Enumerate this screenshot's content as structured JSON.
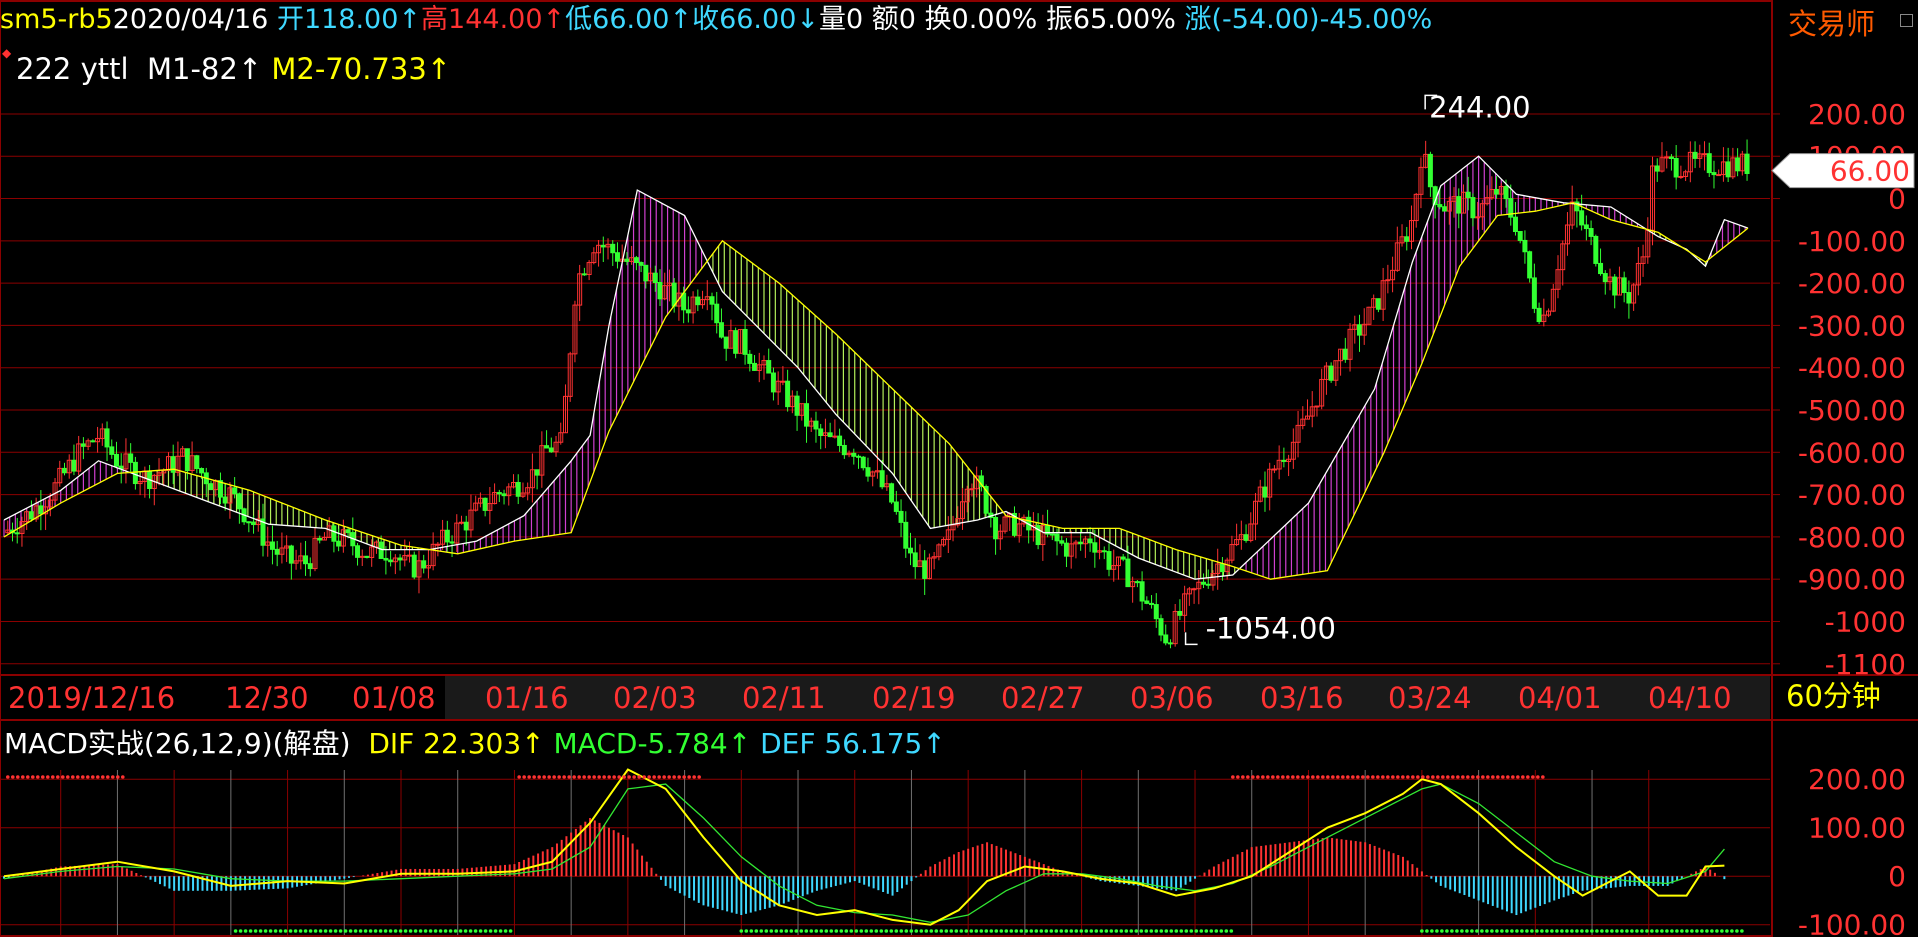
{
  "app": {
    "brand": "交易师",
    "period_label": "60分钟"
  },
  "header": {
    "symbol": "sm5-rb5",
    "date": "2020/04/16",
    "open_label": "开",
    "open_value": "118.00↑",
    "high_label": "高",
    "high_value": "144.00↑",
    "low_label": "低",
    "low_value": "66.00↑",
    "close_label": "收",
    "close_value": "66.00↓",
    "volume": "量0",
    "amount": "额0",
    "turnover": "换0.00%",
    "amplitude": "振65.00%",
    "change": "涨(-54.00)-45.00%"
  },
  "indicator1": {
    "name": "222 yttl",
    "m1_label": "M1",
    "m1_value": "-82↑",
    "m2_label": "M2",
    "m2_value": "-70.733↑"
  },
  "indicator2": {
    "name": "MACD实战(26,12,9)(解盘)",
    "dif_label": "DIF",
    "dif_value": "22.303↑",
    "macd_label": "MACD",
    "macd_value": "-5.784↑",
    "def_label": "DEF",
    "def_value": "56.175↑"
  },
  "colors": {
    "up": "#ff3232",
    "down": "#32ff32",
    "white": "#ffffff",
    "yellow": "#ffff00",
    "cyan": "#3fd8ff",
    "magenta": "#d040d0",
    "lightgreen": "#b4f05a",
    "grid": "#8b0000"
  },
  "chart_data": [
    {
      "type": "candlestick",
      "name": "sm5-rb5 60min spread",
      "y_ticks": [
        "200.00",
        "100.00",
        "0",
        "-100.00",
        "-200.00",
        "-300.00",
        "-400.00",
        "-500.00",
        "-600.00",
        "-700.00",
        "-800.00",
        "-900.00",
        "-1000",
        "-1100"
      ],
      "y_tick_values": [
        200,
        100,
        0,
        -100,
        -200,
        -300,
        -400,
        -500,
        -600,
        -700,
        -800,
        -900,
        -1000,
        -1100
      ],
      "ylim": [
        -1110,
        285
      ],
      "x_labels": [
        "2019/12/16",
        "12/30",
        "01/08",
        "01/16",
        "02/03",
        "02/11",
        "02/19",
        "02/27",
        "03/06",
        "03/16",
        "03/24",
        "04/01",
        "04/10"
      ],
      "current_price": "66.00",
      "annotations": [
        {
          "text": "244.00",
          "value": 244,
          "kind": "high"
        },
        {
          "text": "-1054.00",
          "value": -1054,
          "kind": "low"
        }
      ],
      "close_path_points": [
        [
          0,
          -790
        ],
        [
          30,
          -740
        ],
        [
          55,
          -680
        ],
        [
          80,
          -600
        ],
        [
          100,
          -560
        ],
        [
          120,
          -620
        ],
        [
          150,
          -660
        ],
        [
          170,
          -640
        ],
        [
          190,
          -610
        ],
        [
          215,
          -660
        ],
        [
          240,
          -700
        ],
        [
          265,
          -770
        ],
        [
          285,
          -830
        ],
        [
          305,
          -860
        ],
        [
          320,
          -860
        ],
        [
          340,
          -800
        ],
        [
          365,
          -810
        ],
        [
          385,
          -840
        ],
        [
          410,
          -830
        ],
        [
          425,
          -870
        ],
        [
          440,
          -870
        ],
        [
          460,
          -820
        ],
        [
          480,
          -780
        ],
        [
          500,
          -740
        ],
        [
          520,
          -700
        ],
        [
          540,
          -680
        ],
        [
          560,
          -650
        ],
        [
          575,
          -590
        ],
        [
          590,
          -580
        ],
        [
          605,
          -200
        ],
        [
          625,
          -100
        ],
        [
          640,
          -120
        ],
        [
          660,
          -150
        ],
        [
          690,
          -200
        ],
        [
          720,
          -260
        ],
        [
          745,
          -200
        ],
        [
          760,
          -330
        ],
        [
          780,
          -340
        ],
        [
          800,
          -400
        ],
        [
          820,
          -450
        ],
        [
          840,
          -500
        ],
        [
          860,
          -560
        ],
        [
          880,
          -580
        ],
        [
          900,
          -590
        ],
        [
          920,
          -650
        ],
        [
          940,
          -720
        ],
        [
          960,
          -860
        ],
        [
          980,
          -880
        ],
        [
          1000,
          -800
        ],
        [
          1020,
          -650
        ],
        [
          1035,
          -700
        ],
        [
          1050,
          -780
        ],
        [
          1070,
          -770
        ],
        [
          1090,
          -790
        ],
        [
          1110,
          -810
        ],
        [
          1130,
          -830
        ],
        [
          1150,
          -800
        ],
        [
          1170,
          -860
        ],
        [
          1190,
          -890
        ],
        [
          1210,
          -960
        ],
        [
          1230,
          -1040
        ],
        [
          1250,
          -960
        ],
        [
          1270,
          -900
        ],
        [
          1290,
          -850
        ],
        [
          1310,
          -800
        ],
        [
          1330,
          -700
        ],
        [
          1350,
          -610
        ],
        [
          1370,
          -560
        ],
        [
          1390,
          -460
        ],
        [
          1410,
          -380
        ],
        [
          1430,
          -320
        ],
        [
          1450,
          -260
        ],
        [
          1470,
          -150
        ],
        [
          1490,
          -50
        ],
        [
          1500,
          120
        ],
        [
          1510,
          20
        ],
        [
          1525,
          -20
        ],
        [
          1540,
          -10
        ],
        [
          1560,
          -30
        ],
        [
          1580,
          20
        ],
        [
          1600,
          -60
        ],
        [
          1620,
          -250
        ],
        [
          1630,
          -280
        ],
        [
          1645,
          -140
        ],
        [
          1660,
          -20
        ],
        [
          1680,
          -110
        ],
        [
          1700,
          -200
        ],
        [
          1720,
          -230
        ],
        [
          1735,
          -130
        ],
        [
          1745,
          80
        ]
      ],
      "m1_path_points": [
        [
          0,
          -760
        ],
        [
          60,
          -690
        ],
        [
          100,
          -620
        ],
        [
          160,
          -670
        ],
        [
          220,
          -720
        ],
        [
          280,
          -770
        ],
        [
          340,
          -780
        ],
        [
          400,
          -830
        ],
        [
          450,
          -830
        ],
        [
          500,
          -810
        ],
        [
          550,
          -750
        ],
        [
          600,
          -620
        ],
        [
          620,
          -560
        ],
        [
          640,
          -300
        ],
        [
          670,
          20
        ],
        [
          720,
          -40
        ],
        [
          760,
          -220
        ],
        [
          800,
          -310
        ],
        [
          840,
          -400
        ],
        [
          880,
          -510
        ],
        [
          940,
          -650
        ],
        [
          980,
          -780
        ],
        [
          1030,
          -760
        ],
        [
          1060,
          -740
        ],
        [
          1100,
          -790
        ],
        [
          1150,
          -790
        ],
        [
          1200,
          -850
        ],
        [
          1260,
          -900
        ],
        [
          1300,
          -890
        ],
        [
          1380,
          -720
        ],
        [
          1450,
          -450
        ],
        [
          1490,
          -150
        ],
        [
          1520,
          30
        ],
        [
          1560,
          100
        ],
        [
          1600,
          10
        ],
        [
          1650,
          -10
        ],
        [
          1700,
          -20
        ],
        [
          1750,
          -90
        ],
        [
          1780,
          -120
        ],
        [
          1800,
          -160
        ],
        [
          1820,
          -50
        ],
        [
          1845,
          -70
        ]
      ],
      "m2_path_points": [
        [
          0,
          -800
        ],
        [
          60,
          -720
        ],
        [
          120,
          -650
        ],
        [
          180,
          -640
        ],
        [
          260,
          -690
        ],
        [
          340,
          -760
        ],
        [
          420,
          -820
        ],
        [
          480,
          -840
        ],
        [
          540,
          -810
        ],
        [
          600,
          -790
        ],
        [
          640,
          -550
        ],
        [
          700,
          -280
        ],
        [
          760,
          -100
        ],
        [
          820,
          -200
        ],
        [
          880,
          -320
        ],
        [
          940,
          -450
        ],
        [
          1000,
          -580
        ],
        [
          1060,
          -750
        ],
        [
          1120,
          -780
        ],
        [
          1180,
          -780
        ],
        [
          1240,
          -830
        ],
        [
          1300,
          -870
        ],
        [
          1340,
          -900
        ],
        [
          1400,
          -880
        ],
        [
          1460,
          -600
        ],
        [
          1500,
          -390
        ],
        [
          1540,
          -160
        ],
        [
          1580,
          -40
        ],
        [
          1620,
          -30
        ],
        [
          1660,
          -10
        ],
        [
          1700,
          -50
        ],
        [
          1750,
          -80
        ],
        [
          1800,
          -150
        ],
        [
          1845,
          -70
        ]
      ]
    },
    {
      "type": "macd",
      "name": "MACD实战(26,12,9)",
      "y_ticks": [
        "200.00",
        "100.00",
        "0",
        "-100.00"
      ],
      "y_tick_values": [
        200,
        100,
        0,
        -100
      ],
      "ylim": [
        -115,
        250
      ],
      "dif_points": [
        [
          0,
          0
        ],
        [
          60,
          15
        ],
        [
          120,
          30
        ],
        [
          180,
          10
        ],
        [
          240,
          -20
        ],
        [
          300,
          -10
        ],
        [
          360,
          -15
        ],
        [
          420,
          5
        ],
        [
          480,
          5
        ],
        [
          540,
          10
        ],
        [
          580,
          30
        ],
        [
          620,
          110
        ],
        [
          660,
          220
        ],
        [
          700,
          180
        ],
        [
          740,
          80
        ],
        [
          780,
          -10
        ],
        [
          820,
          -60
        ],
        [
          860,
          -80
        ],
        [
          900,
          -70
        ],
        [
          940,
          -90
        ],
        [
          980,
          -100
        ],
        [
          1010,
          -70
        ],
        [
          1040,
          -10
        ],
        [
          1080,
          20
        ],
        [
          1120,
          10
        ],
        [
          1160,
          -5
        ],
        [
          1200,
          -15
        ],
        [
          1240,
          -40
        ],
        [
          1280,
          -25
        ],
        [
          1320,
          0
        ],
        [
          1360,
          50
        ],
        [
          1400,
          100
        ],
        [
          1440,
          130
        ],
        [
          1480,
          170
        ],
        [
          1500,
          200
        ],
        [
          1520,
          190
        ],
        [
          1560,
          130
        ],
        [
          1600,
          60
        ],
        [
          1640,
          0
        ],
        [
          1670,
          -40
        ],
        [
          1690,
          -20
        ],
        [
          1720,
          10
        ],
        [
          1750,
          -40
        ],
        [
          1780,
          -40
        ],
        [
          1800,
          20
        ],
        [
          1820,
          22
        ]
      ],
      "def_points": [
        [
          0,
          -5
        ],
        [
          60,
          10
        ],
        [
          120,
          20
        ],
        [
          180,
          15
        ],
        [
          240,
          -5
        ],
        [
          300,
          -10
        ],
        [
          360,
          -10
        ],
        [
          420,
          -5
        ],
        [
          480,
          0
        ],
        [
          540,
          5
        ],
        [
          580,
          15
        ],
        [
          620,
          60
        ],
        [
          660,
          180
        ],
        [
          700,
          190
        ],
        [
          740,
          120
        ],
        [
          780,
          40
        ],
        [
          820,
          -20
        ],
        [
          860,
          -60
        ],
        [
          900,
          -75
        ],
        [
          940,
          -80
        ],
        [
          980,
          -95
        ],
        [
          1020,
          -80
        ],
        [
          1060,
          -30
        ],
        [
          1100,
          5
        ],
        [
          1140,
          5
        ],
        [
          1180,
          -5
        ],
        [
          1220,
          -20
        ],
        [
          1260,
          -30
        ],
        [
          1300,
          -15
        ],
        [
          1340,
          20
        ],
        [
          1380,
          60
        ],
        [
          1420,
          100
        ],
        [
          1460,
          140
        ],
        [
          1500,
          180
        ],
        [
          1520,
          190
        ],
        [
          1560,
          150
        ],
        [
          1600,
          90
        ],
        [
          1640,
          30
        ],
        [
          1680,
          0
        ],
        [
          1720,
          -10
        ],
        [
          1760,
          -15
        ],
        [
          1800,
          10
        ],
        [
          1820,
          56
        ]
      ],
      "histogram": [
        [
          0,
          -5
        ],
        [
          60,
          20
        ],
        [
          120,
          25
        ],
        [
          180,
          -30
        ],
        [
          240,
          -30
        ],
        [
          300,
          -25
        ],
        [
          360,
          -5
        ],
        [
          420,
          15
        ],
        [
          480,
          15
        ],
        [
          540,
          25
        ],
        [
          580,
          60
        ],
        [
          620,
          120
        ],
        [
          660,
          80
        ],
        [
          700,
          -20
        ],
        [
          740,
          -60
        ],
        [
          780,
          -80
        ],
        [
          820,
          -60
        ],
        [
          860,
          -30
        ],
        [
          900,
          -10
        ],
        [
          940,
          -40
        ],
        [
          980,
          20
        ],
        [
          1010,
          50
        ],
        [
          1040,
          70
        ],
        [
          1080,
          40
        ],
        [
          1120,
          10
        ],
        [
          1160,
          -10
        ],
        [
          1200,
          -20
        ],
        [
          1240,
          -30
        ],
        [
          1280,
          20
        ],
        [
          1320,
          60
        ],
        [
          1360,
          70
        ],
        [
          1400,
          80
        ],
        [
          1440,
          70
        ],
        [
          1480,
          40
        ],
        [
          1520,
          -20
        ],
        [
          1560,
          -50
        ],
        [
          1600,
          -80
        ],
        [
          1640,
          -50
        ],
        [
          1670,
          -30
        ],
        [
          1720,
          -20
        ],
        [
          1760,
          -20
        ],
        [
          1800,
          20
        ],
        [
          1820,
          -6
        ]
      ]
    }
  ]
}
